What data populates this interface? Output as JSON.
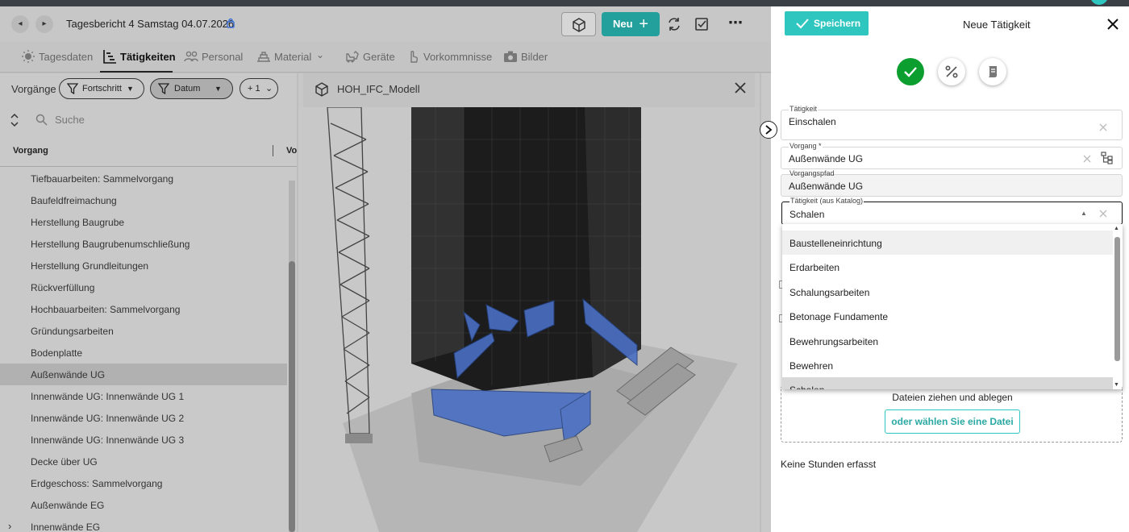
{
  "header": {
    "title": "Tagesbericht 4   Samstag 04.07.2026",
    "new_button": "Neu",
    "back_icon": "chevron-left-icon",
    "forward_icon": "chevron-right-icon",
    "lock_icon": "lock-icon"
  },
  "tabs": [
    {
      "label": "Tagesdaten",
      "icon": "sun-icon"
    },
    {
      "label": "Tätigkeiten",
      "icon": "gantt-icon",
      "active": true
    },
    {
      "label": "Personal",
      "icon": "people-icon"
    },
    {
      "label": "Material",
      "icon": "material-icon"
    },
    {
      "label": "Geräte",
      "icon": "excavator-icon"
    },
    {
      "label": "Vorkommnisse",
      "icon": "hand-icon"
    },
    {
      "label": "Bilder",
      "icon": "camera-icon"
    }
  ],
  "list": {
    "filter_label": "Vorgänge",
    "chips": [
      "Fortschritt",
      "Datum",
      "+ 1"
    ],
    "search_placeholder": "Suche",
    "col1": "Vorgang",
    "col2": "Vo",
    "rows": [
      "Tiefbauarbeiten: Sammelvorgang",
      "Baufeldfreimachung",
      "Herstellung Baugrube",
      "Herstellung Baugrubenumschließung",
      "Herstellung Grundleitungen",
      "Rückverfüllung",
      "Hochbauarbeiten: Sammelvorgang",
      "Gründungsarbeiten",
      "Bodenplatte",
      "Außenwände UG",
      "Innenwände UG: Innenwände UG 1",
      "Innenwände UG: Innenwände UG 2",
      "Innenwände UG: Innenwände UG 3",
      "Decke über UG",
      "Erdgeschoss: Sammelvorgang",
      "Außenwände EG",
      "Innenwände EG"
    ],
    "selected_index": 9
  },
  "viewer": {
    "title": "HOH_IFC_Modell"
  },
  "panel": {
    "save_label": "Speichern",
    "title": "Neue Tätigkeit",
    "fields": {
      "taetigkeit": {
        "label": "Tätigkeit",
        "value": "Einschalen"
      },
      "vorgang": {
        "label": "Vorgang *",
        "value": "Außenwände UG"
      },
      "vorgangspfad": {
        "label": "Vorgangspfad",
        "value": "Außenwände UG"
      },
      "katalog": {
        "label": "Tätigkeit (aus Katalog)",
        "value": "Schalen"
      }
    },
    "dropdown_options": [
      "Baustelleneinrichtung",
      "Erdarbeiten",
      "Schalungsarbeiten",
      "Betonage Fundamente",
      "Bewehrungsarbeiten",
      "Bewehren",
      "Schalen"
    ],
    "dropzone_text": "Dateien ziehen und ablegen",
    "choose_file": "oder wählen Sie eine Datei",
    "no_hours": "Keine Stunden erfasst"
  },
  "colors": {
    "accent": "#2fc6c0",
    "success": "#0c9e2f",
    "model_highlight": "#4a6fc4"
  }
}
